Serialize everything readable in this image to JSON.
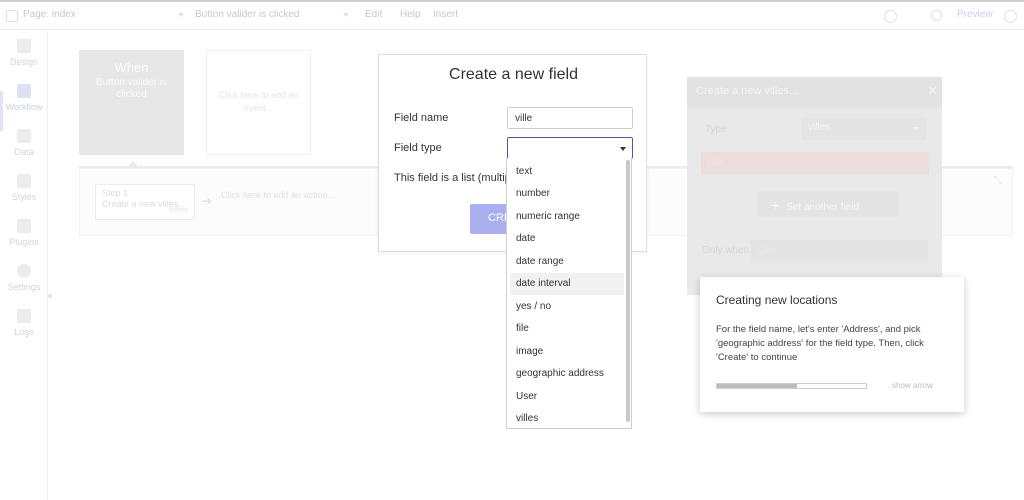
{
  "topbar": {
    "page_label": "Page: index",
    "event_label": "Button valider is clicked",
    "edit_label": "Edit",
    "help_label": "Help",
    "extra_label": "Insert",
    "preview_label": "Preview"
  },
  "sidebar": {
    "items": [
      {
        "label": "Design",
        "icon": "design-icon"
      },
      {
        "label": "Workflow",
        "icon": "workflow-icon"
      },
      {
        "label": "Data",
        "icon": "data-icon"
      },
      {
        "label": "Styles",
        "icon": "styles-icon"
      },
      {
        "label": "Plugins",
        "icon": "plugins-icon"
      },
      {
        "label": "Settings",
        "icon": "settings-icon"
      },
      {
        "label": "Logs",
        "icon": "logs-icon"
      }
    ]
  },
  "workflow": {
    "event_title": "When",
    "event_subtitle": "Button valider is clicked",
    "add_event_label": "Click here to add an event...",
    "step_number": "Step 1",
    "step_title": "Create a new villes...",
    "step_delete": "delete",
    "add_action_label": "Click here to add an action..."
  },
  "action_editor": {
    "title": "Create a new villes...",
    "type_label": "Type",
    "type_value": "villes",
    "field_row": "ville",
    "set_another_label": "Set another field",
    "only_when_label": "Only when",
    "only_when_placeholder": "Click"
  },
  "dialog": {
    "title": "Create a new field",
    "field_name_label": "Field name",
    "field_name_value": "ville",
    "field_type_label": "Field type",
    "list_label": "This field is a list (multip",
    "create_label": "CREATE"
  },
  "dropdown": {
    "options": [
      "text",
      "number",
      "numeric range",
      "date",
      "date range",
      "date interval",
      "yes / no",
      "file",
      "image",
      "geographic address",
      "User",
      "villes"
    ],
    "highlighted": "date interval"
  },
  "tooltip": {
    "title": "Creating new locations",
    "body": "For the field name, let's enter 'Address', and pick 'geographic address' for the field type. Then, click 'Create' to continue",
    "progress": 0.54,
    "show_arrow_label": "show arrow"
  },
  "colors": {
    "accent": "#4a5aa8",
    "create_button": "#aaaff0"
  }
}
